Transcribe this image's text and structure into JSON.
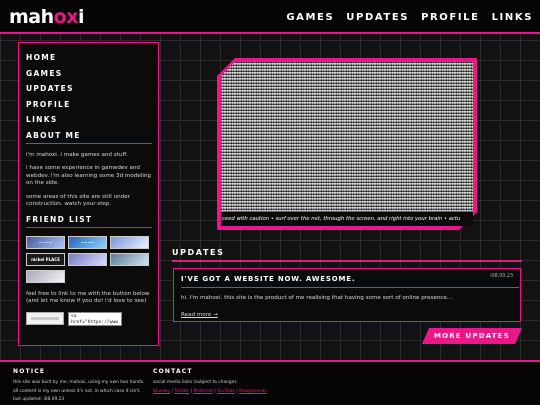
{
  "header": {
    "logo_prefix": "mah",
    "logo_accent": "ox",
    "logo_suffix": "i",
    "nav": [
      "GAMES",
      "UPDATES",
      "PROFILE",
      "LINKS"
    ]
  },
  "sidebar": {
    "nav": [
      "HOME",
      "GAMES",
      "UPDATES",
      "PROFILE",
      "LINKS"
    ],
    "about_heading": "ABOUT ME",
    "about": [
      "i'm mahoxi. i make games and stuff.",
      "i have some experience in gamedev and webdev. i'm also learning some 3d modeling on the side.",
      "some areas of this site are still under construction. watch your step."
    ],
    "friends_heading": "FRIEND LIST",
    "friend_buttons": [
      {
        "label": "~~~~",
        "icon": "friend-button-1"
      },
      {
        "label": "~~~~",
        "icon": "friend-button-2"
      },
      {
        "label": "",
        "icon": "friend-button-3"
      },
      {
        "label": "nickel PLACE",
        "icon": "friend-button-4"
      },
      {
        "label": "",
        "icon": "friend-button-5"
      },
      {
        "label": "",
        "icon": "friend-button-6"
      },
      {
        "label": "",
        "icon": "friend-button-7"
      }
    ],
    "link_note": "feel free to link to me with the button below (and let me know if you do! i'd love to see)",
    "link_code": "<a href=\"https://www.mahoxi.net\"><img src=\"http"
  },
  "screen": {
    "marquee": "ceed with caution  •  surf over the net, through the screen, and right into your brain  •  actu"
  },
  "updates": {
    "heading": "UPDATES",
    "post_title": "I'VE GOT A WEBSITE NOW. AWESOME.",
    "post_date": "i08.09.23",
    "post_body": "hi. i'm mahoxi. this site is the product of me realising that having some sort of online presence...",
    "read_more": "Read more →",
    "more_button": "MORE UPDATES"
  },
  "footer": {
    "notice_heading": "NOTICE",
    "notice_lines": [
      "this site was built by me, mahoxi, using my own two hands.",
      "all content is my own unless it's not, in which case it isn't.",
      "last updated: i08.09.23"
    ],
    "contact_heading": "CONTACT",
    "contact_line": "social media links (subject to change):",
    "contact_links": [
      "Bluesky",
      "Tumblr",
      "Pinterest",
      "YouTube",
      "Newgrounds"
    ]
  },
  "colors": {
    "accent": "#e8178a",
    "background": "#121212"
  }
}
